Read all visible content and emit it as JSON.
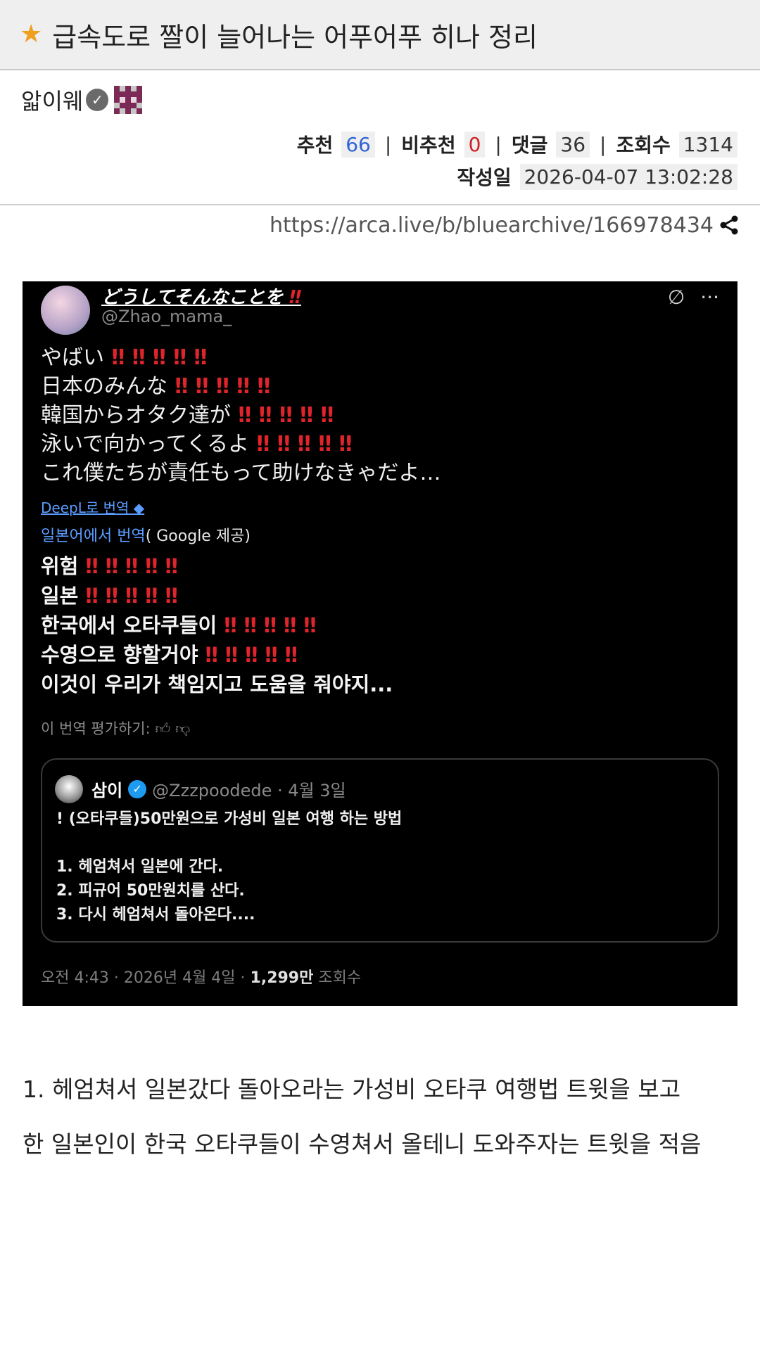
{
  "header": {
    "title": "급속도로 짤이 늘어나는 어푸어푸 히나 정리"
  },
  "author": {
    "name": "앏이웨"
  },
  "stats": {
    "recommend_label": "추천",
    "recommend": "66",
    "notrecommend_label": "비추천",
    "notrecommend": "0",
    "comments_label": "댓글",
    "comments": "36",
    "views_label": "조회수",
    "views": "1314",
    "date_label": "작성일",
    "date": "2026-04-07 13:02:28"
  },
  "post": {
    "url": "https://arca.live/b/bluearchive/166978434"
  },
  "tweet": {
    "name": "どうしてそんなことを",
    "handle": "@Zhao_mama_",
    "lines_ja": [
      "やばい",
      "日本のみんな",
      "韓国からオタク達が",
      "泳いで向かってくるよ",
      "これ僕たちが責任もって助けなきゃだよ…"
    ],
    "deepl": "DeepL로 번역",
    "google_prefix": "일본어에서 번역",
    "google_suffix": "( Google 제공)",
    "lines_ko": [
      "위험",
      "일본",
      "한국에서 오타쿠들이",
      "수영으로 향할거야",
      "이것이 우리가 책임지고 도움을 줘야지..."
    ],
    "rate": "이 번역 평가하기:",
    "quote": {
      "name": "삼이",
      "handle": "@Zzzpoodede · 4월 3일",
      "body": "! (오타쿠들)50만원으로 가성비 일본 여행 하는 방법\n\n1. 헤엄쳐서 일본에 간다.\n2. 피규어 50만원치를 산다.\n3. 다시 헤엄쳐서 돌아온다...."
    },
    "footer_time": "오전 4:43 · 2026년 4월 4일 · ",
    "footer_views": "1,299만",
    "footer_label": " 조회수"
  },
  "body": {
    "para1": "1. 헤엄쳐서 일본갔다 돌아오라는 가성비 오타쿠 여행법 트윗을 보고",
    "para2": "한 일본인이 한국 오타쿠들이 수영쳐서 올테니 도와주자는 트윗을 적음"
  }
}
